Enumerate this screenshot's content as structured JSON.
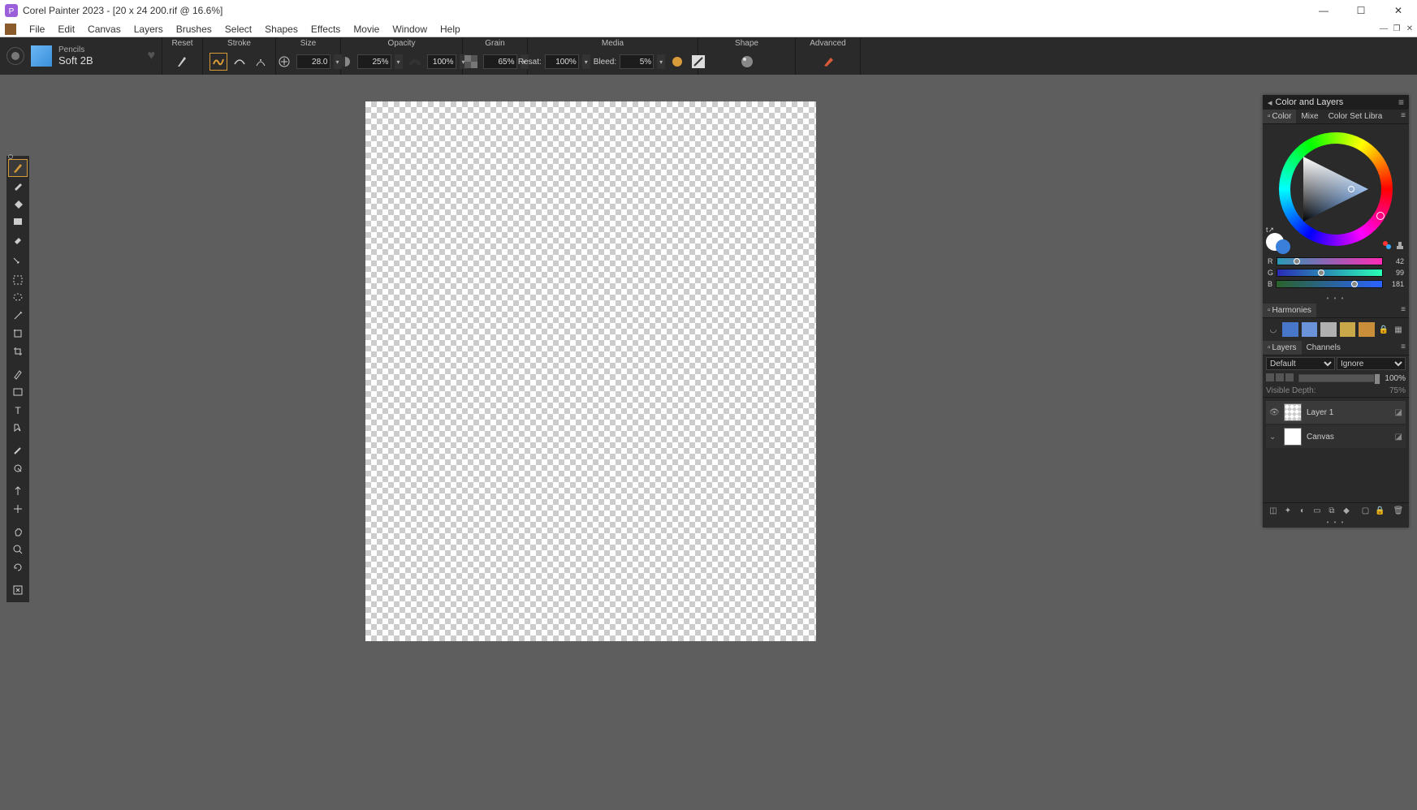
{
  "title_bar": {
    "app_name": "Corel Painter 2023",
    "document": "[20 x 24 200.rif @ 16.6%]"
  },
  "menu": {
    "items": [
      "File",
      "Edit",
      "Canvas",
      "Layers",
      "Brushes",
      "Select",
      "Shapes",
      "Effects",
      "Movie",
      "Window",
      "Help"
    ]
  },
  "brush_selector": {
    "category": "Pencils",
    "name": "Soft 2B"
  },
  "propbar": {
    "reset": "Reset",
    "stroke": "Stroke",
    "size": {
      "label": "Size",
      "value": "28.0"
    },
    "opacity": {
      "label": "Opacity",
      "value": "25%",
      "value2": "100%"
    },
    "grain": {
      "label": "Grain",
      "value": "65%"
    },
    "media": {
      "label": "Media",
      "resat_label": "Resat:",
      "resat": "100%",
      "bleed_label": "Bleed:",
      "bleed": "5%"
    },
    "shape": "Shape",
    "advanced": "Advanced"
  },
  "color_panel": {
    "title": "Color and Layers",
    "tabs": [
      "Color",
      "Mixe",
      "Color Set Libra"
    ],
    "rgb": {
      "r": "42",
      "g": "99",
      "b": "181"
    },
    "harmonies_label": "Harmonies",
    "harmony_colors": [
      "#4876c9",
      "#6a93d9",
      "#b0b0b0",
      "#c9a84a",
      "#c98e3a"
    ]
  },
  "layers_panel": {
    "tabs": [
      "Layers",
      "Channels"
    ],
    "blend": "Default",
    "ignore": "Ignore",
    "opacity": "100%",
    "visible_depth_label": "Visible Depth:",
    "visible_depth": "75%",
    "layers": [
      {
        "name": "Layer 1",
        "kind": "check"
      },
      {
        "name": "Canvas",
        "kind": "white"
      }
    ]
  }
}
